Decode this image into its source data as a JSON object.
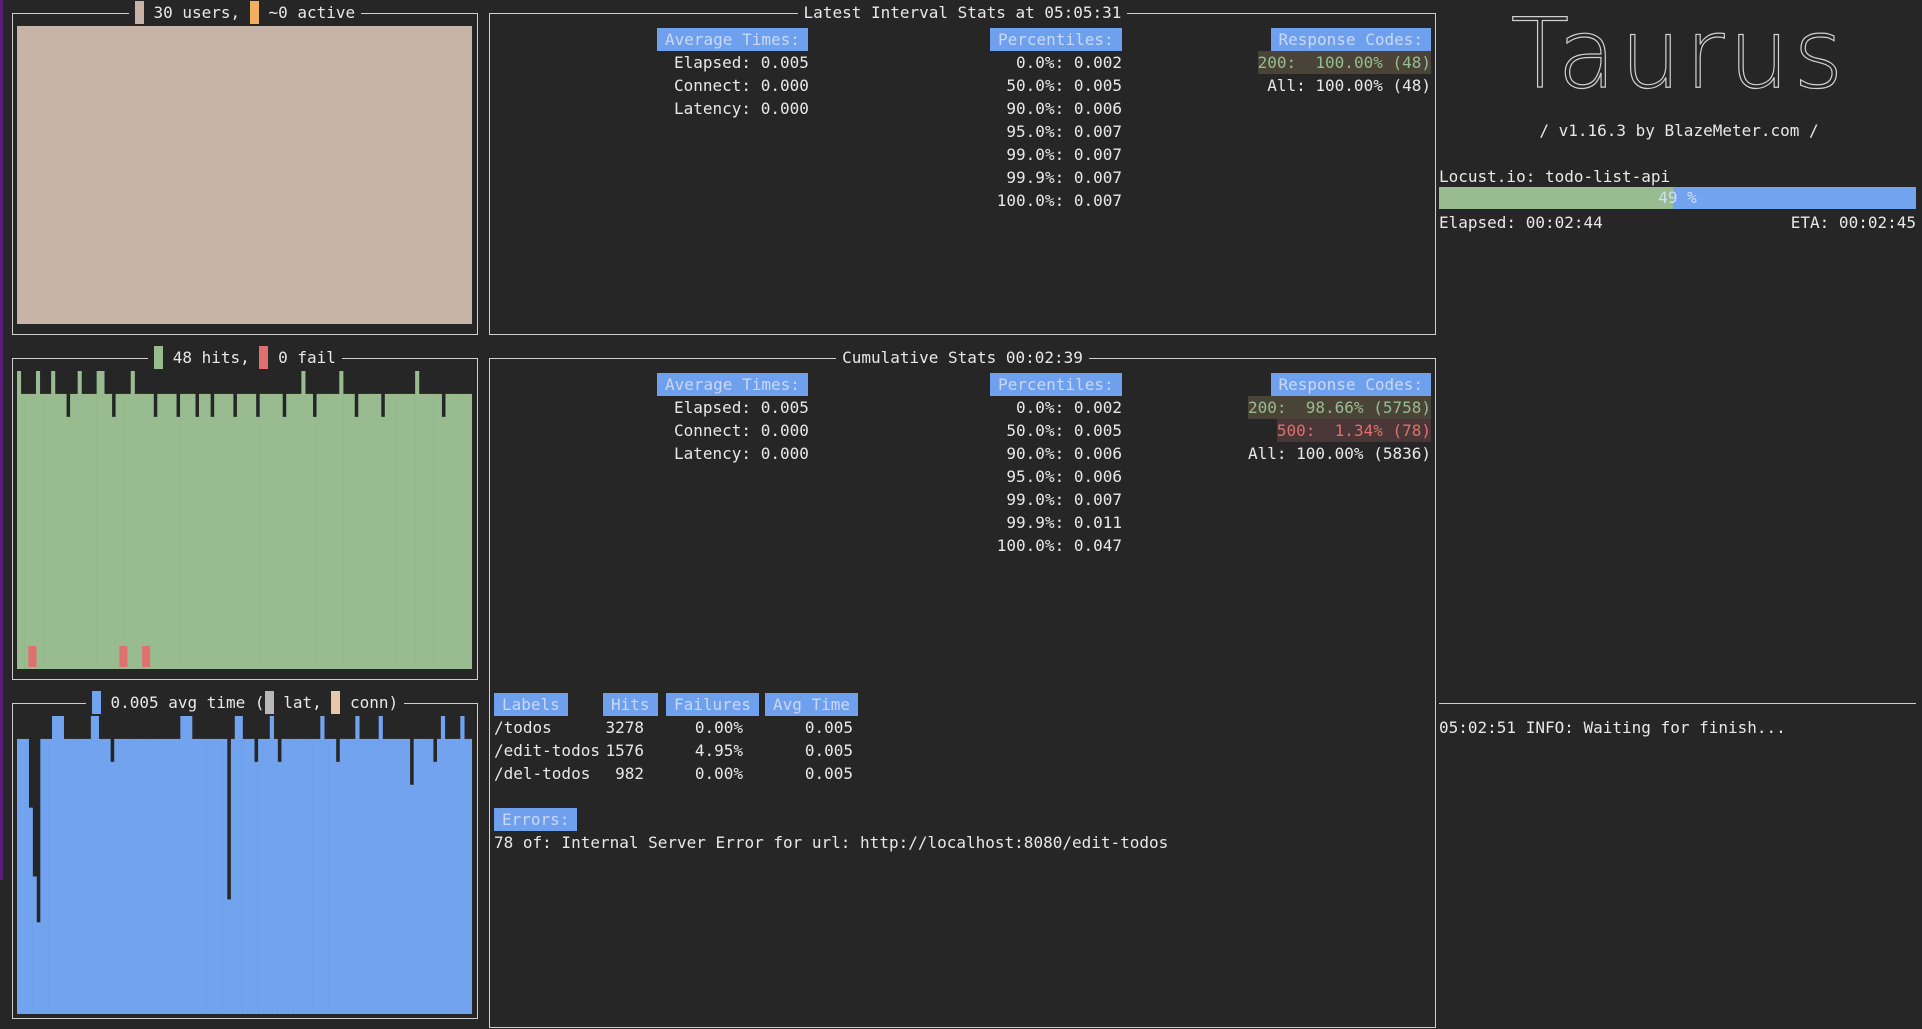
{
  "colors": {
    "background": "#262626",
    "users_fill": "#c8b4a6",
    "hits_green": "#98bc8f",
    "fail_red": "#e07070",
    "avg_blue": "#72a3ee",
    "lat_gray": "#b8b8b8",
    "conn_tan": "#e8c8a8",
    "active_orange": "#f0b060",
    "header_blue": "#6fa0ee",
    "border": "#cfcfcf"
  },
  "users_panel": {
    "users_label": "30 users,",
    "active_label": "~0 active"
  },
  "hits_panel": {
    "hits_label": "48 hits,",
    "fail_label": "0 fail"
  },
  "time_panel": {
    "avg_label": "0.005 avg time (",
    "lat_label": "lat,",
    "conn_label": "conn)"
  },
  "latest": {
    "title": "Latest Interval Stats at 05:05:31",
    "avg_header": "Average Times:",
    "avg_rows": [
      "Elapsed: 0.005",
      "Connect: 0.000",
      "Latency: 0.000"
    ],
    "pct_header": "Percentiles:",
    "pct_rows": [
      "0.0%: 0.002",
      "50.0%: 0.005",
      "90.0%: 0.006",
      "95.0%: 0.007",
      "99.0%: 0.007",
      "99.9%: 0.007",
      "100.0%: 0.007"
    ],
    "codes_header": "Response Codes:",
    "code_200": "200:  100.00% (48)",
    "code_all": "All: 100.00% (48)"
  },
  "cumulative": {
    "title": "Cumulative Stats 00:02:39",
    "avg_header": "Average Times:",
    "avg_rows": [
      "Elapsed: 0.005",
      "Connect: 0.000",
      "Latency: 0.000"
    ],
    "pct_header": "Percentiles:",
    "pct_rows": [
      "0.0%: 0.002",
      "50.0%: 0.005",
      "90.0%: 0.006",
      "95.0%: 0.006",
      "99.0%: 0.007",
      "99.9%: 0.011",
      "100.0%: 0.047"
    ],
    "codes_header": "Response Codes:",
    "code_200": "200:  98.66% (5758)",
    "code_500": "500:  1.34% (78)",
    "code_all": "All: 100.00% (5836)"
  },
  "labels_table": {
    "headers": [
      "Labels",
      "Hits",
      "Failures",
      "Avg Time"
    ],
    "rows": [
      [
        "/todos",
        "3278",
        "0.00%",
        "0.005"
      ],
      [
        "/edit-todos",
        "1576",
        "4.95%",
        "0.005"
      ],
      [
        "/del-todos",
        "982",
        "0.00%",
        "0.005"
      ]
    ]
  },
  "errors": {
    "header": "Errors:",
    "message": "78 of: Internal Server Error for url: http://localhost:8080/edit-todos"
  },
  "taurus": {
    "logo": "Taurus",
    "version": "/ v1.16.3 by BlazeMeter.com /",
    "executor": "Locust.io: todo-list-api",
    "progress_percent": 49,
    "progress_text": "49 %",
    "elapsed": "Elapsed: 00:02:44",
    "eta": "ETA: 00:02:45"
  },
  "log": {
    "line": "05:02:51 INFO: Waiting for finish..."
  },
  "series": {
    "hits_level": [
      13,
      12,
      12,
      12,
      12,
      13,
      12,
      12,
      12,
      13,
      12,
      12,
      12,
      11,
      12,
      12,
      13,
      12,
      12,
      12,
      12,
      13,
      13,
      12,
      12,
      11,
      12,
      12,
      12,
      12,
      13,
      12,
      12,
      12,
      12,
      12,
      11,
      12,
      12,
      12,
      12,
      12,
      11,
      12,
      12,
      12,
      12,
      11,
      12,
      12,
      12,
      11,
      12,
      12,
      12,
      12,
      12,
      11,
      12,
      12,
      12,
      12,
      12,
      11,
      12,
      12,
      12,
      12,
      12,
      12,
      11,
      12,
      12,
      12,
      12,
      13,
      12,
      12,
      11,
      12,
      12,
      12,
      12,
      12,
      12,
      13,
      12,
      12,
      12,
      11,
      12,
      12,
      12,
      12,
      12,
      12,
      11,
      12,
      12,
      12,
      12,
      12,
      12,
      12,
      12,
      13,
      12,
      12,
      12,
      12,
      12,
      12,
      11,
      12,
      12,
      12,
      12,
      12,
      12,
      12
    ],
    "fail_marks": [
      3,
      27,
      33
    ],
    "time_level": [
      12,
      12,
      12,
      9,
      6,
      4,
      12,
      12,
      12,
      13,
      13,
      13,
      12,
      12,
      12,
      12,
      12,
      12,
      12,
      13,
      13,
      12,
      12,
      12,
      11,
      12,
      12,
      12,
      12,
      12,
      12,
      12,
      12,
      12,
      12,
      12,
      12,
      12,
      12,
      12,
      12,
      12,
      13,
      13,
      13,
      12,
      12,
      12,
      12,
      12,
      12,
      12,
      12,
      12,
      5,
      12,
      13,
      13,
      12,
      12,
      12,
      11,
      12,
      12,
      12,
      13,
      12,
      11,
      12,
      12,
      12,
      12,
      12,
      12,
      12,
      12,
      12,
      12,
      13,
      12,
      12,
      12,
      11,
      12,
      12,
      12,
      12,
      13,
      12,
      12,
      12,
      12,
      12,
      13,
      12,
      12,
      12,
      12,
      12,
      12,
      12,
      10,
      12,
      12,
      12,
      12,
      12,
      11,
      12,
      13,
      12,
      12,
      12,
      12,
      13,
      12,
      12
    ]
  }
}
